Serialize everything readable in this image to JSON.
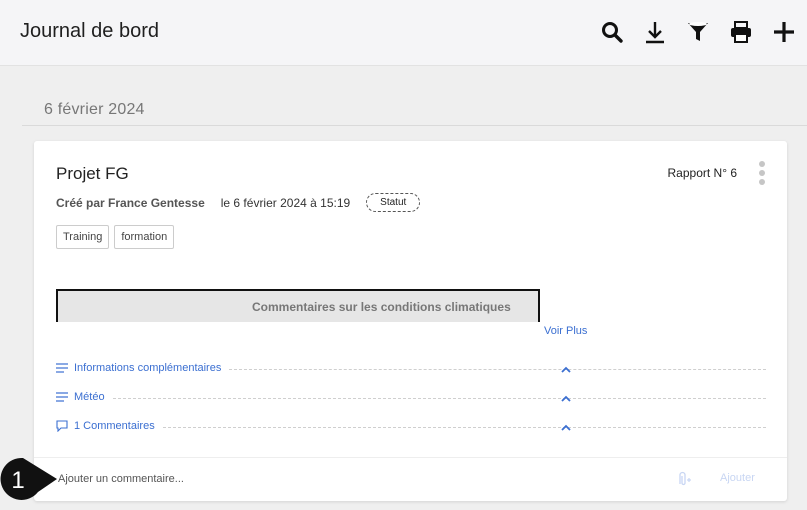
{
  "header": {
    "title": "Journal de bord",
    "icons": [
      "search-icon",
      "download-icon",
      "filter-icon",
      "print-icon",
      "add-icon"
    ]
  },
  "date_group": {
    "label": "6 février 2024"
  },
  "card": {
    "title": "Projet FG",
    "report": "Rapport N° 6",
    "created_by": "Créé par France Gentesse",
    "created_at": "le 6 février 2024 à 15:19",
    "status": "Statut",
    "tags": [
      "Training",
      "formation"
    ],
    "climate_label": "Commentaires sur les conditions climatiques",
    "voir_plus": "Voir Plus",
    "sections": [
      {
        "label": "Informations complémentaires",
        "icon": "lines-icon"
      },
      {
        "label": "Météo",
        "icon": "lines-icon"
      },
      {
        "label": "1 Commentaires",
        "icon": "comment-icon"
      }
    ],
    "comment": {
      "placeholder": "Ajouter un commentaire...",
      "submit": "Ajouter"
    }
  },
  "callout": {
    "number": "1"
  },
  "colors": {
    "link": "#3b6fd1",
    "callout": "#111111",
    "card": "#ffffff",
    "background": "#efefef"
  }
}
